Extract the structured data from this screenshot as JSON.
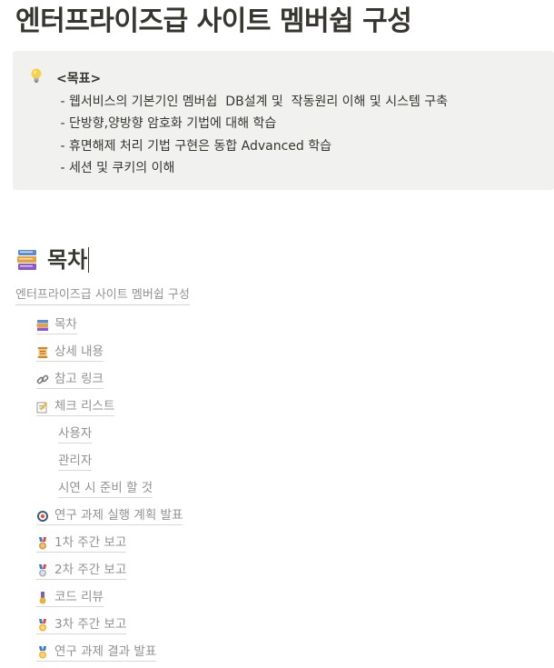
{
  "page": {
    "title": "엔터프라이즈급 사이트 멤버쉽 구성"
  },
  "callout": {
    "icon": "lightbulb-icon",
    "heading": "<목표>",
    "lines": [
      " - 웹서비스의 기본기인 멤버쉽  DB설계 및  작동원리 이해 및 시스템 구축",
      " - 단방향,양방향 암호화 기법에 대해 학습",
      " - 휴면해제 처리 기법 구현은 동합 Advanced 학습",
      " - 세션 및 쿠키의 이해"
    ]
  },
  "section": {
    "icon": "books-icon",
    "heading": "목차"
  },
  "breadcrumb": {
    "label": "엔터프라이즈급 사이트 멤버쉽 구성"
  },
  "toc": [
    {
      "label": "목차",
      "icon": "books-icon"
    },
    {
      "label": "상세 내용",
      "icon": "scroll-icon"
    },
    {
      "label": "참고 링크",
      "icon": "link-icon"
    },
    {
      "label": "체크 리스트",
      "icon": "memo-icon"
    },
    {
      "label": "사용자",
      "icon": ""
    },
    {
      "label": "관리자",
      "icon": ""
    },
    {
      "label": "시연 시 준비 할 것",
      "icon": ""
    },
    {
      "label": "연구 과제 실행 계획 발표",
      "icon": "target-icon"
    },
    {
      "label": "1차 주간 보고",
      "icon": "bronze-medal-icon"
    },
    {
      "label": "2차 주간 보고",
      "icon": "silver-medal-icon"
    },
    {
      "label": "코드 리뷰",
      "icon": "military-medal-icon"
    },
    {
      "label": "3차 주간 보고",
      "icon": "gold-medal-icon"
    },
    {
      "label": "연구 과제 결과 발표",
      "icon": "sports-medal-icon"
    }
  ],
  "colors": {
    "text": "#37352f",
    "muted": "#91918e",
    "callout_bg": "#f1f1ef"
  }
}
